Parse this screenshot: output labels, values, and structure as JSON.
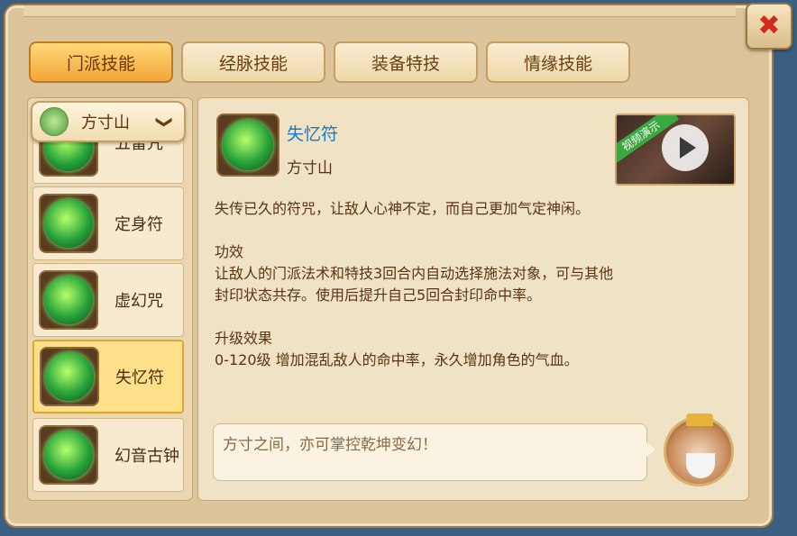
{
  "tabs": [
    {
      "label": "门派技能",
      "active": true
    },
    {
      "label": "经脉技能",
      "active": false
    },
    {
      "label": "装备特技",
      "active": false
    },
    {
      "label": "情缘技能",
      "active": false
    }
  ],
  "close_label": "✖",
  "school_dropdown": {
    "selected": "方寸山",
    "chevron": "❯"
  },
  "skills": [
    {
      "name": "五雷咒",
      "active": false
    },
    {
      "name": "定身符",
      "active": false
    },
    {
      "name": "虚幻咒",
      "active": false
    },
    {
      "name": "失忆符",
      "active": true
    },
    {
      "name": "幻音古钟",
      "active": false
    }
  ],
  "detail": {
    "name": "失忆符",
    "school": "方寸山",
    "video_label": "视频演示",
    "description": "失传已久的符咒，让敌人心神不定，而自己更加气定神闲。",
    "effect_title": "功效",
    "effect_line1": "让敌人的门派法术和特技3回合内自动选择施法对象，可与其他",
    "effect_line2": "封印状态共存。使用后提升自己5回合封印命中率。",
    "upgrade_title": "升级效果",
    "upgrade_text": "0-120级 增加混乱敌人的命中率，永久增加角色的气血。"
  },
  "npc_quote": "方寸之间，亦可掌控乾坤变幻！",
  "colors": {
    "accent": "#f2a63a",
    "link": "#1a7ac8",
    "text": "#5a3412"
  },
  "icons": [
    "close-icon",
    "chevron-down-icon",
    "play-icon",
    "school-emblem-icon"
  ]
}
